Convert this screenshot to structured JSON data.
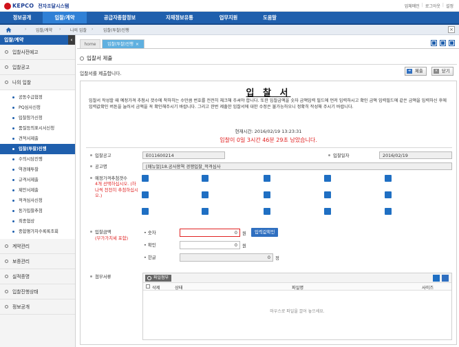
{
  "header": {
    "logo_text": "KEPCO",
    "system_name": "전자조달시스템",
    "util_links": [
      "업체메인",
      "로그아웃",
      "설정"
    ]
  },
  "nav": {
    "items": [
      "정보공개",
      "입찰/계약",
      "공급자종합정보",
      "자재정보유통",
      "업무지원",
      "도움말"
    ],
    "active_index": 1
  },
  "breadcrumb": {
    "items": [
      "입찰/계약",
      "나의 입찰",
      "입찰(투찰)진행"
    ]
  },
  "sidebar": {
    "heading": "입찰/계약",
    "top_items": [
      "입찰사전예고",
      "입찰공고",
      "나의 입찰"
    ],
    "sub_items": [
      "공동수급협정",
      "PQ심사신청",
      "입찰참가신청",
      "품질등의표시서신청",
      "견적서제출",
      "입찰(투찰)진행",
      "수의시담진행",
      "역경매투찰",
      "규격서제출",
      "제안서제출",
      "적격심사신청",
      "동가입찰추첨",
      "최종협상",
      "종합평가자수록록조회"
    ],
    "active_sub": 5,
    "bottom_items": [
      "계약관리",
      "보증관리",
      "실적증명",
      "입찰진행상태",
      "정보공개"
    ]
  },
  "tabs": {
    "items": [
      "home",
      "입찰(투찰)진행"
    ],
    "active_index": 1
  },
  "page": {
    "title": "입찰서 제출",
    "lead": "입찰서를 제출합니다.",
    "submit_label": "제출",
    "close_label": "닫기"
  },
  "form": {
    "title": "입 찰 서",
    "notice": "입찰서 작성할 때 예정가격 추첨시 갯수에 착하히는 수만큼 번호를 전전히 체크해 주셔야 합니다. 또한 입찰금액을 숫자 금액입력 필드에 먼저 입력하시고 확인 금액 입력필드에 같은 금액을 입력하신 후에 입력값확인 버튼을 눌러서 금액을 꼭 확인해주시기 바랍니다. 그리고 한번 제출한 입찰서에 대한 수정은 불가능하오니 정확히 작성해 주시기 바랍니다.",
    "current_time_label": "현재시간: 2016/02/19 13:23:31",
    "remaining_label": "입찰이 0일 3시간 46분 29초 남았습니다.",
    "notice_no_label": "입찰공고",
    "notice_no_value": "E011600214",
    "bid_date_label": "입찰일자",
    "bid_date_value": "2016/02/19",
    "notice_name_label": "공고명",
    "notice_name_value": "[매뉴얼]18.공사용역 경쟁입찰_적격심사",
    "price_select_label": "예정가격추첨갯수",
    "price_select_note": "4개 선택하십시오. (하나씩 천천히 추첨하십시오.)",
    "amount_label": "입찰금액",
    "amount_note": "(부가가치세 포함)",
    "digit_label": "숫자",
    "digit_value": "0",
    "confirm_label": "확인",
    "confirm_value": "0",
    "korean_label": "한글",
    "korean_value": "0",
    "won_unit": "원",
    "won_unit2": "정",
    "check_button": "입력값확인",
    "attach_label": "첨부서류",
    "file_button": "파일첨부",
    "col_delete": "삭제",
    "col_status": "상태",
    "col_filename": "파일명",
    "col_size": "사이즈",
    "empty_msg": "마우스로 파일을 끌어 놓으세요."
  }
}
